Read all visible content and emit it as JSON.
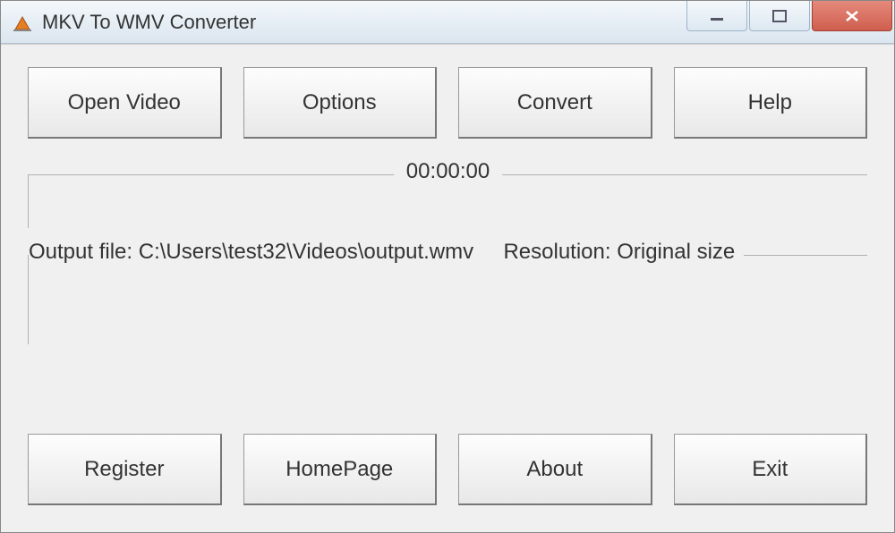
{
  "window": {
    "title": "MKV To WMV Converter"
  },
  "topButtons": {
    "openVideo": "Open Video",
    "options": "Options",
    "convert": "Convert",
    "help": "Help"
  },
  "progress": {
    "time": "00:00:00"
  },
  "info": {
    "text": "Output file: C:\\Users\\test32\\Videos\\output.wmv     Resolution: Original size"
  },
  "bottomButtons": {
    "register": "Register",
    "homePage": "HomePage",
    "about": "About",
    "exit": "Exit"
  }
}
